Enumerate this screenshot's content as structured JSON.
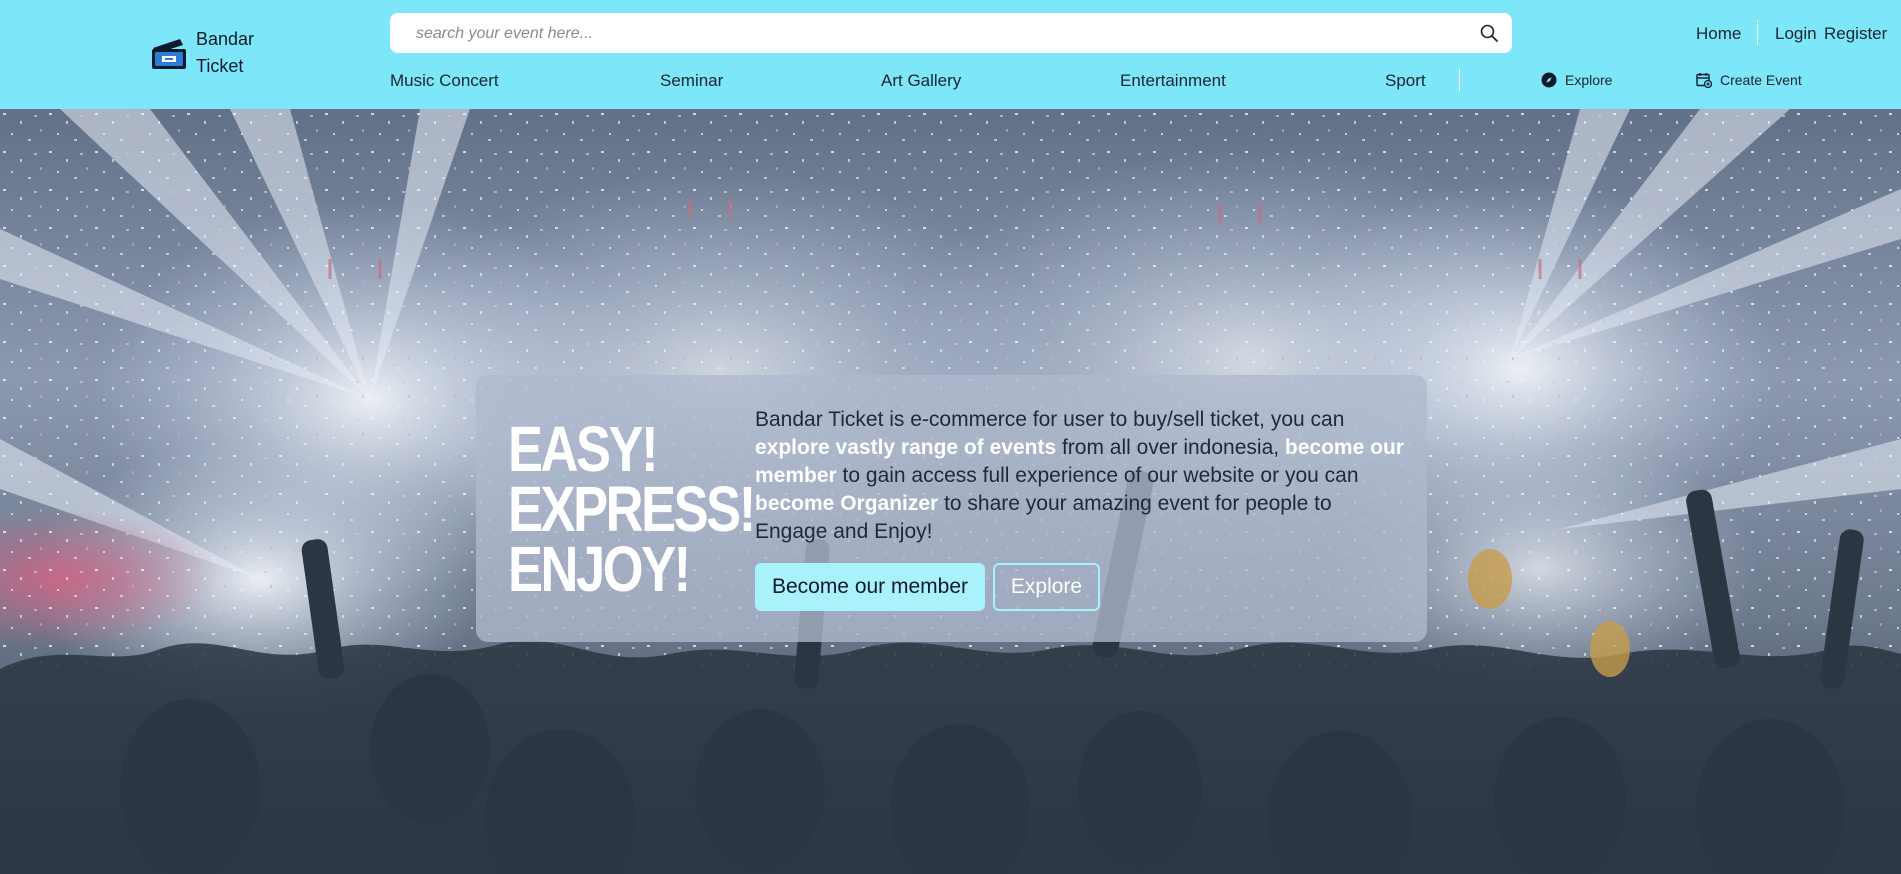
{
  "brand": {
    "line1": "Bandar",
    "line2": "Ticket",
    "icon": "ticket-icon"
  },
  "search": {
    "placeholder": "search your event here...",
    "value": "",
    "icon": "search-icon"
  },
  "top_nav": {
    "home": "Home",
    "login": "Login",
    "register": "Register"
  },
  "categories": [
    "Music Concert",
    "Seminar",
    "Art Gallery",
    "Entertainment",
    "Sport"
  ],
  "secondary_nav": {
    "explore": {
      "label": "Explore",
      "icon": "compass-icon"
    },
    "create_event": {
      "label": "Create Event",
      "icon": "calendar-add-icon"
    }
  },
  "hero": {
    "slogan": [
      "EASY!",
      "EXPRESS!",
      "ENJOY!"
    ],
    "description": {
      "t1": "Bandar Ticket is e-commerce for user to buy/sell ticket, you can ",
      "b1": "explore vastly range of events",
      "t2": " from all over indonesia, ",
      "b2": "become our member",
      "t3": " to gain access full experience of our website or you can ",
      "b3": "become Organizer",
      "t4": " to share your amazing event for people to Engage and Enjoy!"
    },
    "primary_button": "Become our member",
    "secondary_button": "Explore"
  },
  "colors": {
    "header_bg": "#7de6f9",
    "accent_button": "#a9f2fc"
  }
}
